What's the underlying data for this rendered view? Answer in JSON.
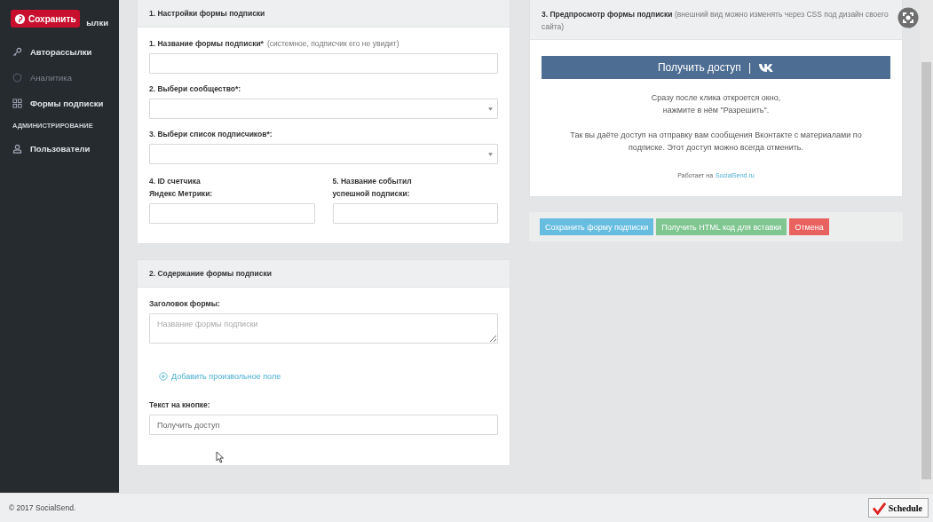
{
  "overlay_button": {
    "label": "Сохранить"
  },
  "sidebar": {
    "items": [
      {
        "kind": "item",
        "label": "ылки",
        "disabled": false
      },
      {
        "kind": "item",
        "label": "Авторассылки",
        "disabled": false
      },
      {
        "kind": "item",
        "label": "Аналитика",
        "disabled": true
      },
      {
        "kind": "item",
        "label": "Формы подписки",
        "disabled": false
      },
      {
        "kind": "heading",
        "label": "АДМИНИСТРИРОВАНИЕ"
      },
      {
        "kind": "item",
        "label": "Пользователи",
        "disabled": false
      }
    ]
  },
  "settings_card": {
    "title": "1. Настройки формы подписки",
    "fields": [
      {
        "kind": "text",
        "label": "1. Название формы подписки*",
        "hint": "(системное, подписчик его не увидит)"
      },
      {
        "kind": "select",
        "label": "2. Выбери сообщество*:"
      },
      {
        "kind": "select",
        "label": "3. Выбери список подписчиков*:"
      }
    ],
    "pair": [
      {
        "label": "4. ID счетчика\nЯндекс Метрики:"
      },
      {
        "label": "5. Название событил\nуспешной подписки:"
      }
    ]
  },
  "content_card": {
    "title": "2. Содержание формы подписки",
    "heading_field": {
      "label": "Заголовок формы:",
      "placeholder": "Название формы подписки"
    },
    "add_link": "Добавить произвольное поле",
    "button_field": {
      "label": "Текст на кнопке:",
      "value": "Получить доступ"
    }
  },
  "preview_card": {
    "title": "**3. Предпросмотр формы подписки** (внешний вид можно изменять через CSS под дизайн своего сайта)",
    "button": {
      "label": "Получить доступ",
      "separator": "|"
    },
    "paragraphs": [
      "Сразу после клика откроется окно,\nнажмите в нём \"Разрешить\".",
      "Так вы даёте доступ на отправку вам сообщения Вконтакте с материалами по подписке. Этот доступ можно всегда отменить."
    ],
    "powered_by": {
      "text": "Работает на",
      "link": "SocialSend.ru"
    }
  },
  "actions": [
    {
      "kind": "info",
      "label": "Сохранить форму подписки"
    },
    {
      "kind": "success",
      "label": "Получить HTML код для вставки"
    },
    {
      "kind": "danger",
      "label": "Отмена"
    }
  ],
  "footer": {
    "text": "© 2017 SocialSend."
  },
  "schedule_button": {
    "label": "Schedule"
  }
}
